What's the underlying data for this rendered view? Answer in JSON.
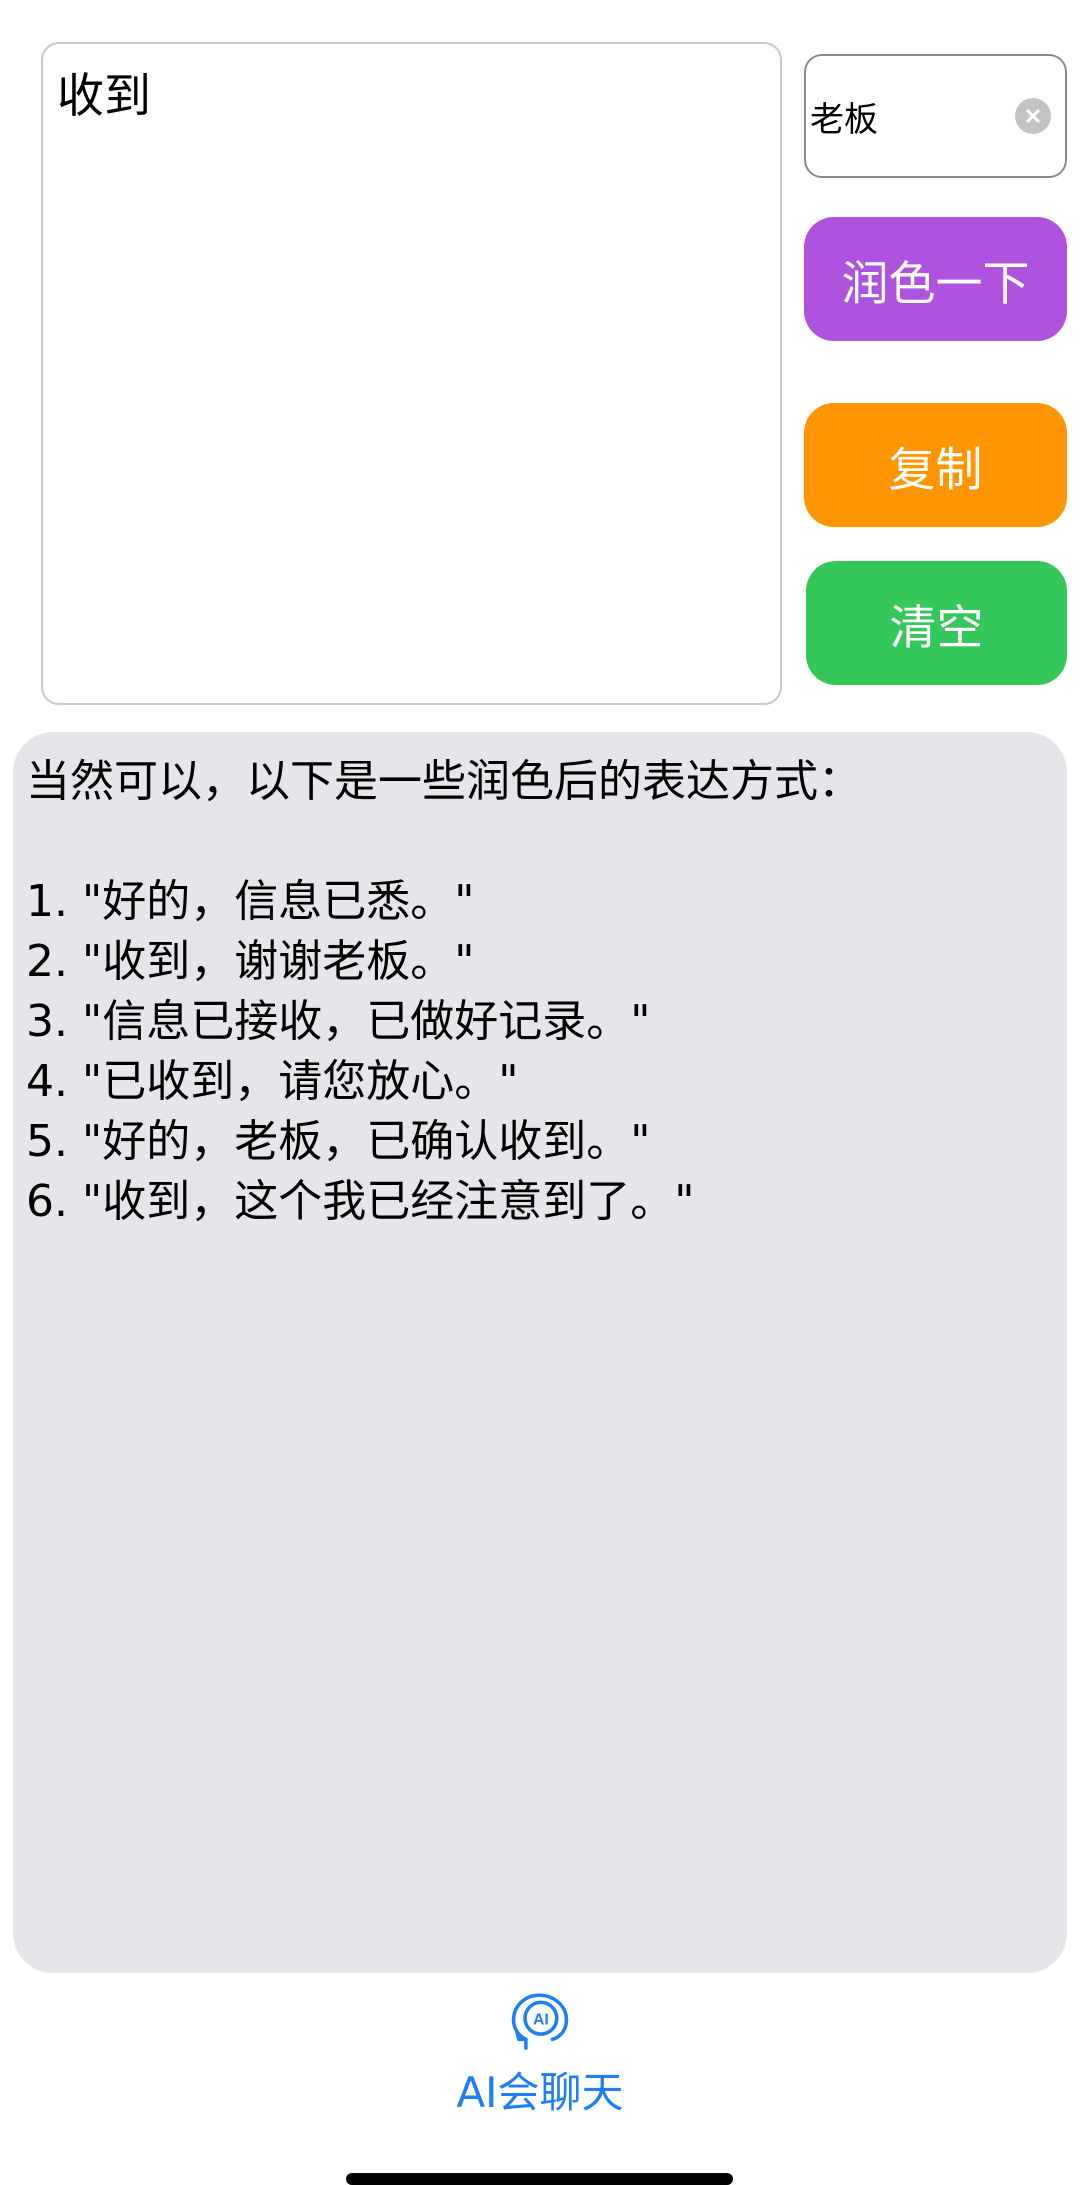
{
  "input": {
    "text": "收到"
  },
  "name_field": {
    "value": "老板",
    "clear_icon": "clear-circle-icon"
  },
  "buttons": {
    "polish": "润色一下",
    "copy": "复制",
    "clear": "清空"
  },
  "result": {
    "lines": [
      "当然可以，以下是一些润色后的表达方式：",
      "",
      "1. \"好的，信息已悉。\"",
      "2. \"收到，谢谢老板。\"",
      "3. \"信息已接收，已做好记录。\"",
      "4. \"已收到，请您放心。\"",
      "5. \"好的，老板，已确认收到。\"",
      "6. \"收到，这个我已经注意到了。\""
    ]
  },
  "tabbar": {
    "items": [
      {
        "label": "AI会聊天",
        "icon": "ai-head-icon",
        "icon_text": "AI"
      }
    ]
  },
  "colors": {
    "polish": "#af52de",
    "copy": "#ff9500",
    "clear": "#34c759",
    "tab_accent": "#1e7ef5",
    "panel": "#e5e5ea"
  }
}
